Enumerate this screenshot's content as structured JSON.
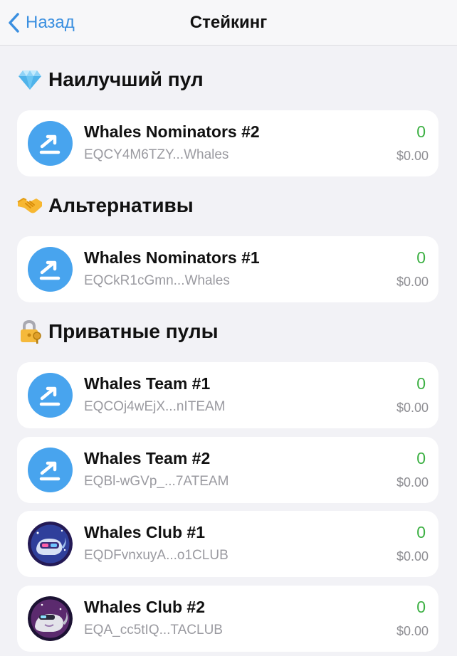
{
  "header": {
    "back_label": "Назад",
    "title": "Стейкинг"
  },
  "sections": [
    {
      "title": "Наилучший пул",
      "icon": "gem-emoji-icon",
      "pools": [
        {
          "name": "Whales Nominators #2",
          "address": "EQCY4M6TZY...Whales",
          "amount": "0",
          "fiat": "$0.00",
          "avatar": "stake-arrow-icon"
        }
      ]
    },
    {
      "title": "Альтернативы",
      "icon": "handshake-emoji-icon",
      "pools": [
        {
          "name": "Whales Nominators #1",
          "address": "EQCkR1cGmn...Whales",
          "amount": "0",
          "fiat": "$0.00",
          "avatar": "stake-arrow-icon"
        }
      ]
    },
    {
      "title": "Приватные пулы",
      "icon": "lock-key-emoji-icon",
      "pools": [
        {
          "name": "Whales Team #1",
          "address": "EQCOj4wEjX...nITEAM",
          "amount": "0",
          "fiat": "$0.00",
          "avatar": "stake-arrow-icon"
        },
        {
          "name": "Whales Team #2",
          "address": "EQBl-wGVp_...7ATEAM",
          "amount": "0",
          "fiat": "$0.00",
          "avatar": "stake-arrow-icon"
        },
        {
          "name": "Whales Club #1",
          "address": "EQDFvnxuyA...o1CLUB",
          "amount": "0",
          "fiat": "$0.00",
          "avatar": "whale-club-blue-avatar"
        },
        {
          "name": "Whales Club #2",
          "address": "EQA_cc5tIQ...TACLUB",
          "amount": "0",
          "fiat": "$0.00",
          "avatar": "whale-club-purple-avatar"
        }
      ]
    }
  ],
  "colors": {
    "accent": "#3a8fe0",
    "amount_green": "#3cb043",
    "avatar_blue": "#48a4ee",
    "background": "#f2f2f6"
  }
}
